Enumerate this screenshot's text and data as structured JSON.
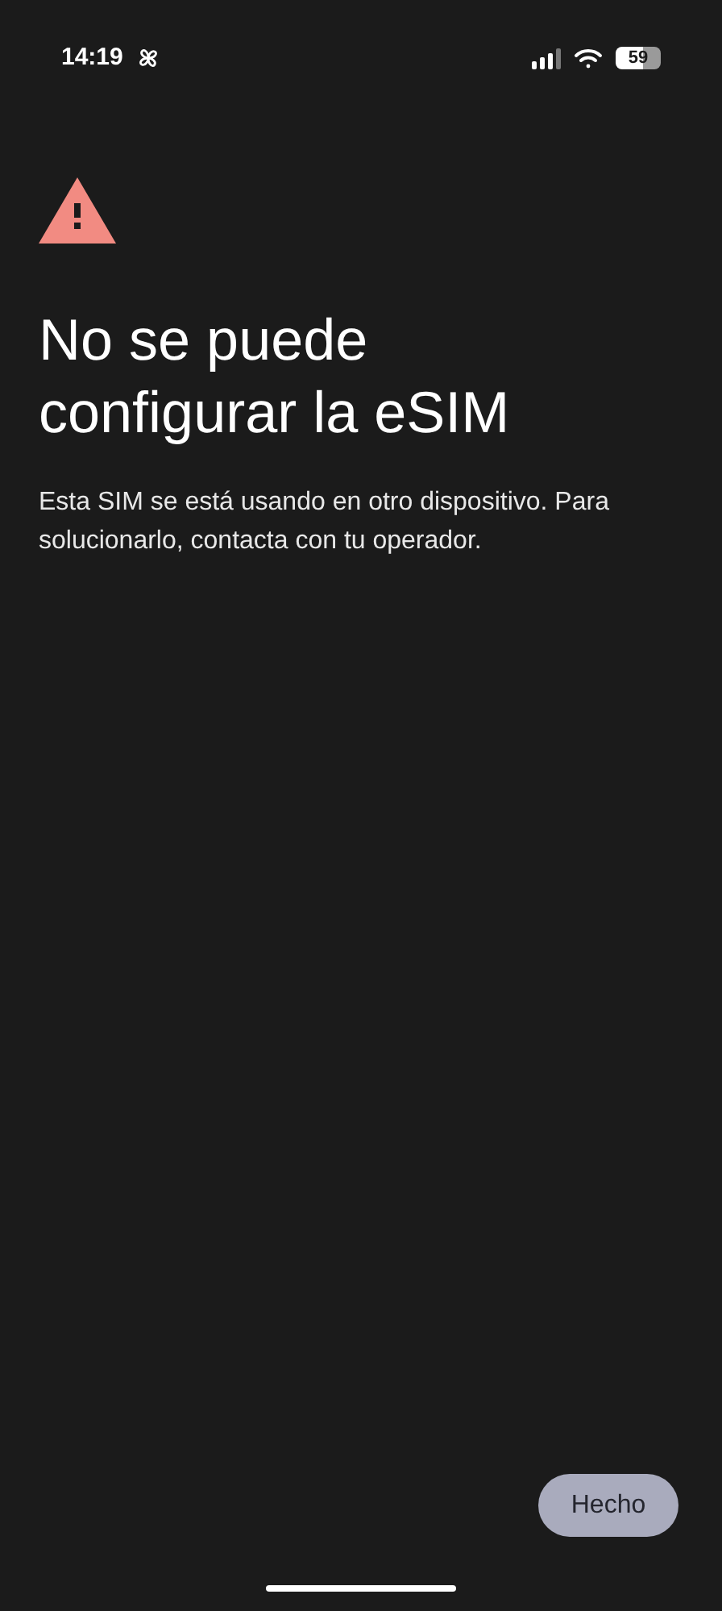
{
  "status_bar": {
    "time": "14:19",
    "battery": "59"
  },
  "title": "No se puede configurar la eSIM",
  "message": "Esta SIM se está usando en otro dispositivo. Para solucionarlo, contacta con tu operador.",
  "buttons": [
    {
      "label": "Hecho"
    }
  ]
}
